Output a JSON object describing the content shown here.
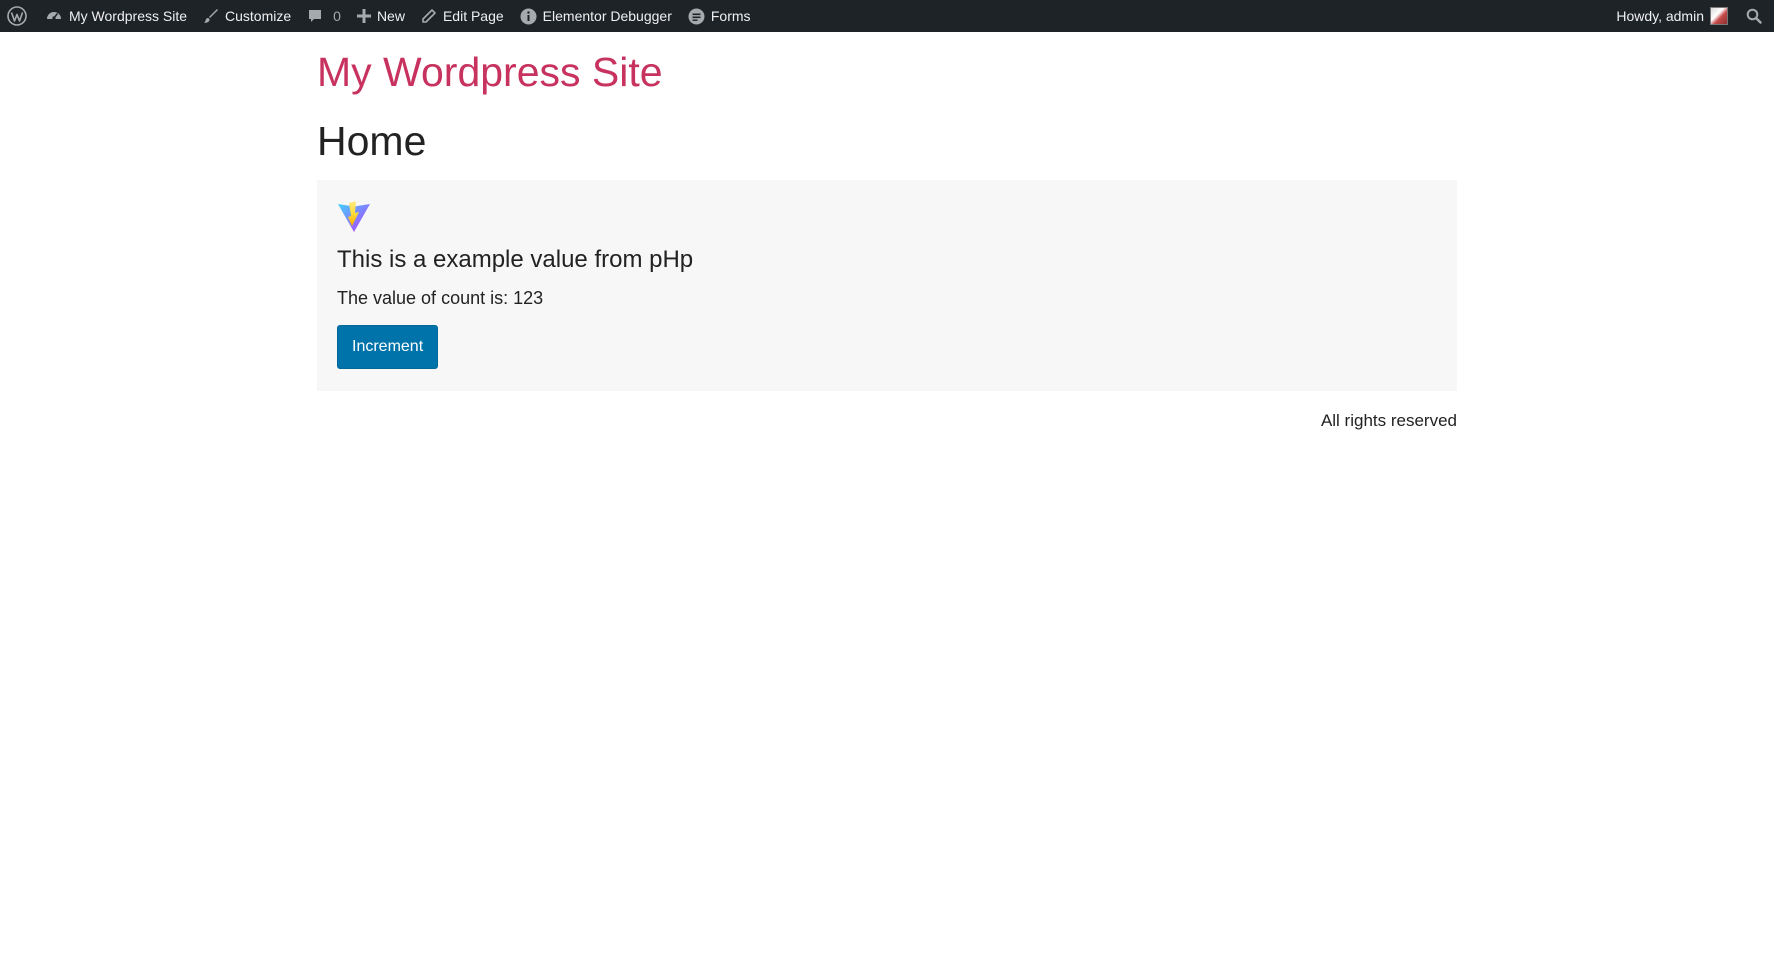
{
  "adminbar": {
    "site_name": "My Wordpress Site",
    "customize": "Customize",
    "comments_count": "0",
    "new": "New",
    "edit_page": "Edit Page",
    "elementor_debugger": "Elementor Debugger",
    "forms": "Forms",
    "howdy": "Howdy, admin"
  },
  "site": {
    "title": "My Wordpress Site",
    "accent_color": "#c7325f"
  },
  "page": {
    "title": "Home"
  },
  "app": {
    "heading": "This is a example value from pHp",
    "count_line": "The value of count is: 123",
    "button_label": "Increment",
    "button_color": "#0073aa"
  },
  "footer": {
    "text": "All rights reserved"
  },
  "icons": {
    "wp": "wordpress-logo-icon",
    "dashboard": "dashboard-icon",
    "brush": "paintbrush-icon",
    "comment": "comment-bubble-icon",
    "plus": "plus-icon",
    "pencil": "pencil-icon",
    "info": "info-icon",
    "forms": "forms-icon",
    "search": "search-icon",
    "vite": "vite-logo-icon"
  }
}
